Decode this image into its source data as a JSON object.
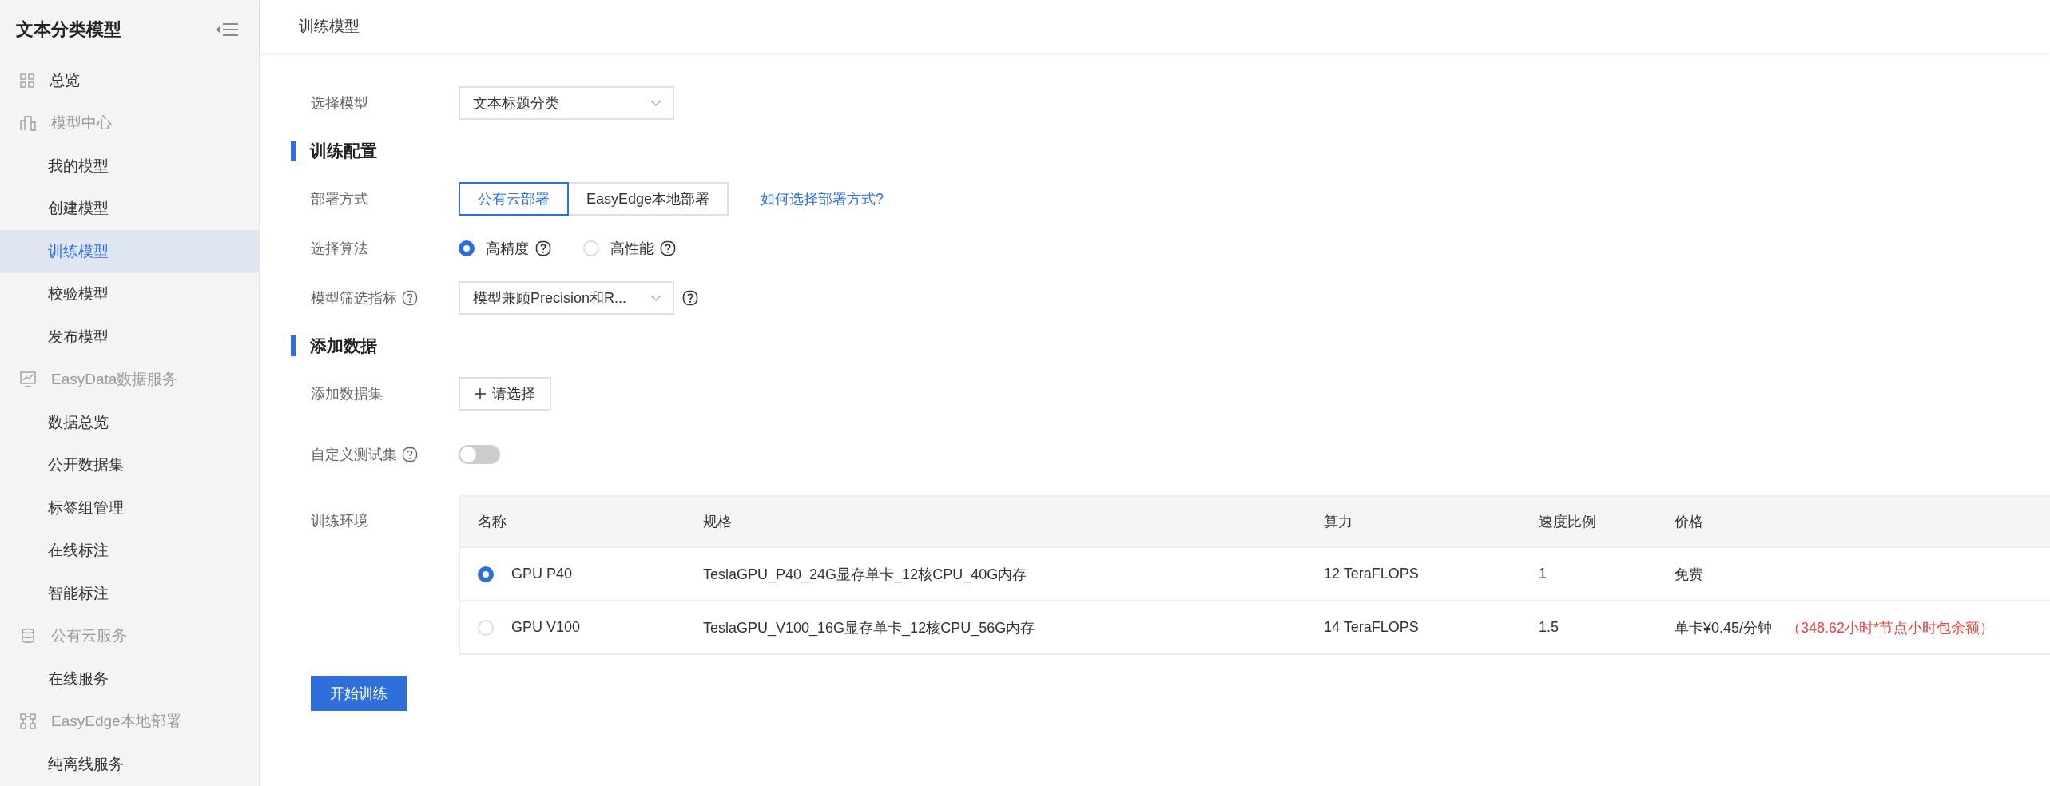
{
  "sidebar": {
    "title": "文本分类模型",
    "items": [
      {
        "label": "总览",
        "kind": "link",
        "selected": false
      },
      {
        "label": "模型中心",
        "kind": "group",
        "children": [
          {
            "label": "我的模型",
            "selected": false
          },
          {
            "label": "创建模型",
            "selected": false
          },
          {
            "label": "训练模型",
            "selected": true
          },
          {
            "label": "校验模型",
            "selected": false
          },
          {
            "label": "发布模型",
            "selected": false
          }
        ]
      },
      {
        "label": "EasyData数据服务",
        "kind": "group",
        "children": [
          {
            "label": "数据总览",
            "selected": false
          },
          {
            "label": "公开数据集",
            "selected": false
          },
          {
            "label": "标签组管理",
            "selected": false
          },
          {
            "label": "在线标注",
            "selected": false
          },
          {
            "label": "智能标注",
            "selected": false
          }
        ]
      },
      {
        "label": "公有云服务",
        "kind": "group",
        "children": [
          {
            "label": "在线服务",
            "selected": false
          }
        ]
      },
      {
        "label": "EasyEdge本地部署",
        "kind": "group",
        "children": [
          {
            "label": "纯离线服务",
            "selected": false
          }
        ]
      }
    ]
  },
  "header": {
    "title": "训练模型"
  },
  "form": {
    "model": {
      "label": "选择模型",
      "value": "文本标题分类"
    },
    "section_config": "训练配置",
    "deploy": {
      "label": "部署方式",
      "options": [
        {
          "label": "公有云部署",
          "selected": true
        },
        {
          "label": "EasyEdge本地部署",
          "selected": false
        }
      ],
      "help_link": "如何选择部署方式?"
    },
    "algorithm": {
      "label": "选择算法",
      "options": [
        {
          "label": "高精度",
          "selected": true
        },
        {
          "label": "高性能",
          "selected": false
        }
      ]
    },
    "metric": {
      "label": "模型筛选指标",
      "value": "模型兼顾Precision和R..."
    },
    "section_data": "添加数据",
    "dataset": {
      "label": "添加数据集",
      "button": "请选择"
    },
    "custom_test": {
      "label": "自定义测试集",
      "on": false
    },
    "environment": {
      "label": "训练环境",
      "columns": [
        "名称",
        "规格",
        "算力",
        "速度比例",
        "价格"
      ],
      "rows": [
        {
          "selected": true,
          "name": "GPU P40",
          "spec": "TeslaGPU_P40_24G显存单卡_12核CPU_40G内存",
          "compute": "12 TeraFLOPS",
          "speed": "1",
          "price": "免费"
        },
        {
          "selected": false,
          "name": "GPU V100",
          "spec": "TeslaGPU_V100_16G显存单卡_12核CPU_56G内存",
          "compute": "14 TeraFLOPS",
          "speed": "1.5",
          "price": "单卡¥0.45/分钟",
          "note": "（348.62小时*节点小时包余额）"
        }
      ]
    },
    "submit": "开始训练"
  }
}
